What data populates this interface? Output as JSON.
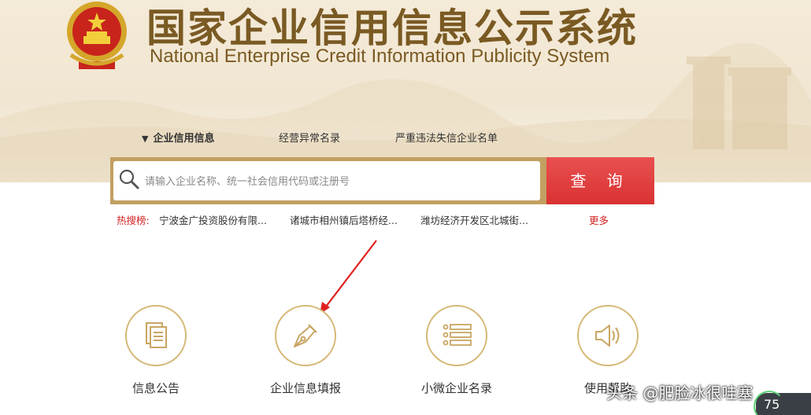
{
  "header": {
    "title_cn": "国家企业信用信息公示系统",
    "title_en": "National Enterprise Credit Information Publicity System"
  },
  "tabs": [
    {
      "label": "企业信用信息",
      "active": true
    },
    {
      "label": "经营异常名录",
      "active": false
    },
    {
      "label": "严重违法失信企业名单",
      "active": false
    }
  ],
  "search": {
    "placeholder": "请输入企业名称、统一社会信用代码或注册号",
    "button_label": "查 询"
  },
  "hot_search": {
    "label": "热搜榜:",
    "items": [
      "宁波金广投资股份有限...",
      "诸城市相州镇后塔桥经...",
      "潍坊经济开发区北城街..."
    ],
    "more_label": "更多"
  },
  "features": [
    {
      "label": "信息公告",
      "icon": "document-icon"
    },
    {
      "label": "企业信息填报",
      "icon": "pen-nib-icon"
    },
    {
      "label": "小微企业名录",
      "icon": "list-icon"
    },
    {
      "label": "使用帮助",
      "icon": "speaker-icon"
    }
  ],
  "overlay": {
    "watermark": "头条 @肥脸冰很哇塞",
    "zoom": "75"
  },
  "colors": {
    "title": "#7a5a23",
    "search_frame": "#c2a061",
    "search_button": "#e04040",
    "hot_label": "#d32222",
    "feature_ring": "#d6b877",
    "annotation_arrow": "#e02020"
  }
}
